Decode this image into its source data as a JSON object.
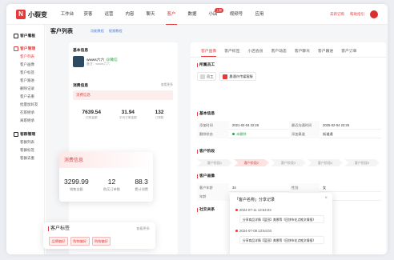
{
  "brand": {
    "logo_glyph": "N",
    "name": "小裂变"
  },
  "nav": {
    "items": [
      "工作台",
      "获客",
      "运营",
      "内容",
      "聊天",
      "客户",
      "数据",
      "小店",
      "视频号",
      "应用"
    ],
    "badge": "上新"
  },
  "topright": {
    "order": "去新订购",
    "help": "帮助指引"
  },
  "sidebar": {
    "groups": [
      {
        "title": "客户看板",
        "items": []
      },
      {
        "title": "客户管理",
        "items": [
          "客户列表",
          "客户画像",
          "客户标签",
          "客户跟进",
          "删除记录",
          "客户去重",
          "批量加好友",
          "在职继承",
          "离职继承"
        ]
      },
      {
        "title": "客群管理",
        "items": [
          "客群列表",
          "客群标签",
          "客群去重"
        ]
      }
    ],
    "active": "客户列表"
  },
  "page": {
    "title": "客户列表",
    "links": [
      "功能教程",
      "视频教程"
    ]
  },
  "left": {
    "basic_title": "基本信息",
    "name": "wwws六六",
    "tag": "@微信",
    "sub": "备注：wwws六六",
    "consume_title": "消费信息",
    "more": "查看更多",
    "consume_sub": "消费信息",
    "stats": [
      {
        "value": "7639.54",
        "label": "已购金额"
      },
      {
        "value": "31.94",
        "label": "平均订单金额"
      },
      {
        "value": "132",
        "label": "订单数"
      }
    ],
    "tag_title": "客户标签"
  },
  "float_consume": {
    "title": "消费信息",
    "stats": [
      {
        "value": "3299.99",
        "label": "销售金额"
      },
      {
        "value": "12",
        "label": "购买订单数"
      },
      {
        "value": "88.3",
        "label": "累计消费"
      }
    ]
  },
  "float_tags": {
    "title": "客户标签",
    "more": "查看更多",
    "chips": [
      "品牌偏好",
      "购物偏好",
      "购物偏好"
    ]
  },
  "right": {
    "tabs": [
      "客户画像",
      "客户标签",
      "小店会员",
      "客户动态",
      "客户聊天",
      "客户跟进",
      "客户订单"
    ],
    "staff_title": "所属员工",
    "staff": [
      {
        "name": "员工"
      },
      {
        "name": "晨通许传媒客服"
      }
    ],
    "basic_title": "基本信息",
    "basic_rows": [
      [
        "添加时间",
        "2021-02-04 22:26",
        "最近沟通时间",
        "2025-02-04 22:26"
      ],
      [
        "删除状态",
        "未删除",
        "添加渠道",
        "街道通"
      ]
    ],
    "stage_title": "客户阶段",
    "stages": [
      "客户阶段1",
      "客户阶段2",
      "客户阶段3",
      "客户阶段4",
      "客户阶段5"
    ],
    "active_stage": 1,
    "portrait_title": "客户画像",
    "portrait_rows": [
      [
        "客户年龄",
        "34",
        "性别",
        "女"
      ],
      [
        "年龄",
        "--",
        "",
        ""
      ]
    ],
    "social_title": "社交关系"
  },
  "popup": {
    "title": "「客户名称」分享记录",
    "events": [
      {
        "time": "2024-07-11 13:54:03",
        "text": "分享商品详情【蓝田】美景等《回饼市花点推文情报》"
      },
      {
        "time": "2024-07-08 13:54:03",
        "text": "分享商品详情【蓝田】美景等《回饼市花点推文情报》"
      }
    ]
  },
  "colors": {
    "accent": "#e33b3b",
    "link": "#4a7bd6",
    "success": "#2aa344"
  }
}
